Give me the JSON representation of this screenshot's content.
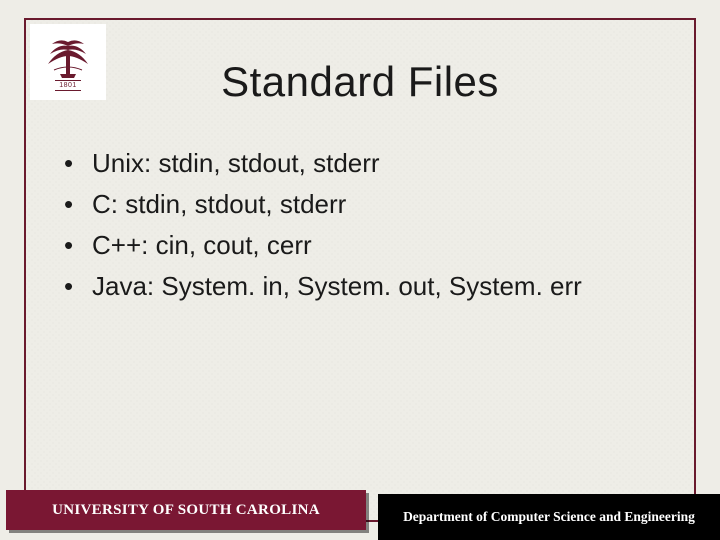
{
  "logo": {
    "name": "university-of-south-carolina-logo",
    "year": "1801",
    "accent": "#6a1a2e"
  },
  "title": "Standard Files",
  "bullets": [
    "Unix: stdin, stdout, stderr",
    "C: stdin, stdout, stderr",
    "C++: cin, cout, cerr",
    "Java: System. in, System. out, System. err"
  ],
  "footer": {
    "left": "UNIVERSITY OF SOUTH CAROLINA",
    "right": "Department of Computer Science and Engineering"
  }
}
